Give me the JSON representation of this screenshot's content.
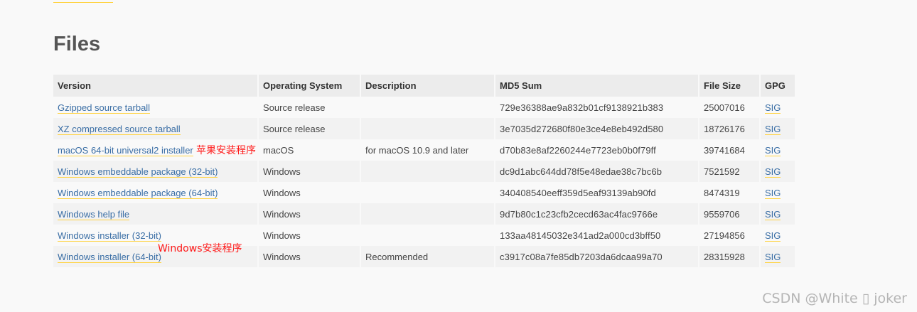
{
  "section": {
    "title": "Files"
  },
  "table": {
    "headers": [
      "Version",
      "Operating System",
      "Description",
      "MD5 Sum",
      "File Size",
      "GPG"
    ],
    "rows": [
      {
        "version": "Gzipped source tarball",
        "os": "Source release",
        "description": "",
        "md5": "729e36388ae9a832b01cf9138921b383",
        "size": "25007016",
        "gpg": "SIG"
      },
      {
        "version": "XZ compressed source tarball",
        "os": "Source release",
        "description": "",
        "md5": "3e7035d272680f80e3ce4e8eb492d580",
        "size": "18726176",
        "gpg": "SIG"
      },
      {
        "version": "macOS 64-bit universal2 installer",
        "os": "macOS",
        "description": "for macOS 10.9 and later",
        "md5": "d70b83e8af2260244e7723eb0b0f79ff",
        "size": "39741684",
        "gpg": "SIG"
      },
      {
        "version": "Windows embeddable package (32-bit)",
        "os": "Windows",
        "description": "",
        "md5": "dc9d1abc644dd78f5e48edae38c7bc6b",
        "size": "7521592",
        "gpg": "SIG"
      },
      {
        "version": "Windows embeddable package (64-bit)",
        "os": "Windows",
        "description": "",
        "md5": "340408540eeff359d5eaf93139ab90fd",
        "size": "8474319",
        "gpg": "SIG"
      },
      {
        "version": "Windows help file",
        "os": "Windows",
        "description": "",
        "md5": "9d7b80c1c23cfb2cecd63ac4fac9766e",
        "size": "9559706",
        "gpg": "SIG"
      },
      {
        "version": "Windows installer (32-bit)",
        "os": "Windows",
        "description": "",
        "md5": "133aa48145032e341ad2a000cd3bff50",
        "size": "27194856",
        "gpg": "SIG"
      },
      {
        "version": "Windows installer (64-bit)",
        "os": "Windows",
        "description": "Recommended",
        "md5": "c3917c08a7fe85db7203da6dcaa99a70",
        "size": "28315928",
        "gpg": "SIG"
      }
    ]
  },
  "annotations": {
    "mac": "苹果安装程序",
    "windows": "Windows安装程序"
  },
  "watermark": "CSDN @White ▯ joker",
  "colors": {
    "link": "#3a6ea5",
    "link_underline": "#ffd343",
    "annotation": "#ff1a1a",
    "header_bg": "#ececec"
  }
}
